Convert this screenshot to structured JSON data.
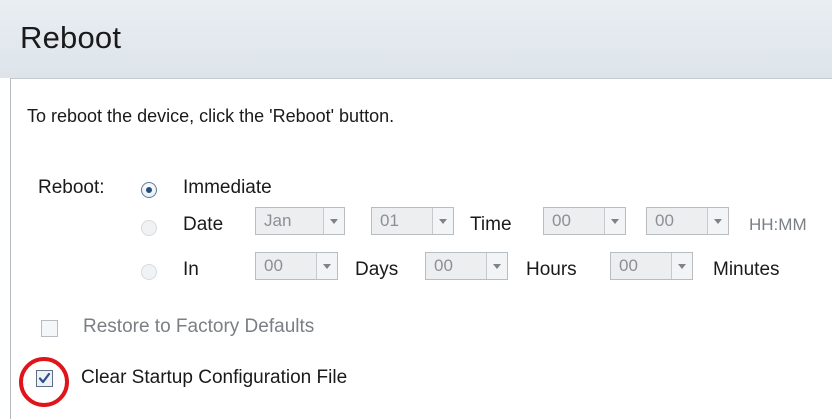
{
  "header": {
    "title": "Reboot"
  },
  "instructions": "To reboot the device, click the 'Reboot' button.",
  "reboot": {
    "label": "Reboot:",
    "options": {
      "immediate": {
        "label": "Immediate",
        "selected": true
      },
      "date": {
        "label": "Date",
        "month": "Jan",
        "day": "01",
        "time_label": "Time",
        "hour": "00",
        "minute": "00",
        "format_hint": "HH:MM",
        "selected": false
      },
      "in": {
        "label": "In",
        "days_value": "00",
        "days_label": "Days",
        "hours_value": "00",
        "hours_label": "Hours",
        "minutes_value": "00",
        "minutes_label": "Minutes",
        "selected": false
      }
    }
  },
  "checkboxes": {
    "restore_defaults": {
      "label": "Restore to Factory Defaults",
      "checked": false,
      "enabled": false
    },
    "clear_startup": {
      "label": "Clear Startup Configuration File",
      "checked": true,
      "enabled": true
    }
  },
  "colors": {
    "highlight": "#e0141b",
    "radio_dot": "#1e4f86"
  }
}
